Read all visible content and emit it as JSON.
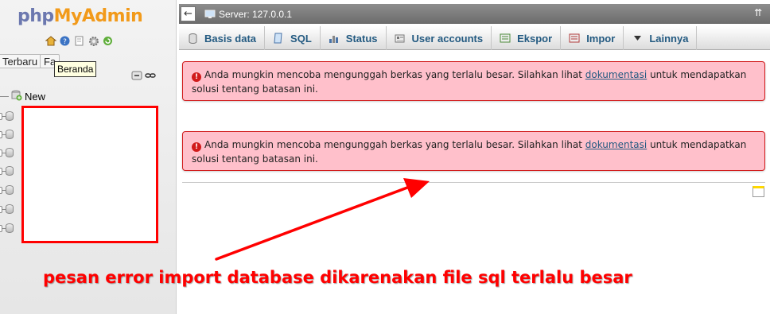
{
  "colors": {
    "accent": "#235a81",
    "annotation": "#ff0000",
    "error_bg": "#ffc0cb",
    "error_border": "#d11b1b"
  },
  "nav": {
    "logo_part1": "php",
    "logo_part2": "MyAdmin",
    "icons": [
      "home-icon",
      "info-icon",
      "docs-icon",
      "settings-icon",
      "reload-icon"
    ],
    "tab_recent": "Terbaru",
    "tab_favorites": "Fa",
    "tooltip": "Beranda",
    "tree_new": "New"
  },
  "topbar": {
    "back_icon": "←",
    "server_label": "Server: 127.0.0.1",
    "collapse_icon": "⇈"
  },
  "menu": {
    "items": [
      {
        "label": "Basis data",
        "icon": "database-icon"
      },
      {
        "label": "SQL",
        "icon": "sql-icon"
      },
      {
        "label": "Status",
        "icon": "status-icon"
      },
      {
        "label": "User accounts",
        "icon": "users-icon"
      },
      {
        "label": "Ekspor",
        "icon": "export-icon"
      },
      {
        "label": "Impor",
        "icon": "import-icon"
      },
      {
        "label": "Lainnya",
        "icon": "more-icon"
      }
    ]
  },
  "errors": [
    {
      "text_before": "Anda mungkin mencoba mengunggah berkas yang terlalu besar. Silahkan lihat",
      "link": "dokumentasi",
      "text_after": "untuk mendapatkan solusi tentang batasan ini."
    },
    {
      "text_before": "Anda mungkin mencoba mengunggah berkas yang terlalu besar. Silahkan lihat",
      "link": "dokumentasi",
      "text_after": "untuk mendapatkan solusi tentang batasan ini."
    }
  ],
  "annotation": {
    "caption": "pesan error import database dikarenakan file sql terlalu besar"
  }
}
